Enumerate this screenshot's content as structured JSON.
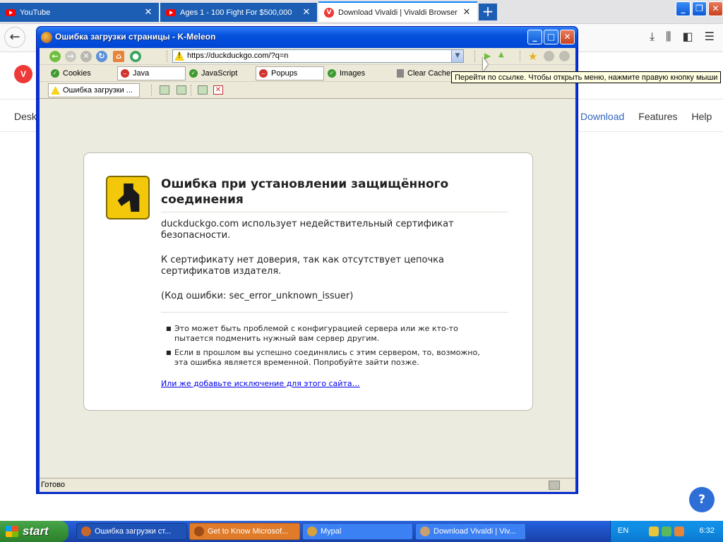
{
  "firefox": {
    "tabs": [
      {
        "label": "YouTube",
        "icon": "youtube-icon"
      },
      {
        "label": "Ages 1 - 100 Fight For $500,000",
        "icon": "youtube-icon"
      },
      {
        "label": "Download Vivaldi | Vivaldi Browser",
        "icon": "vivaldi-icon"
      }
    ],
    "new_tab": "+",
    "vivaldi_logo": "V",
    "vivaldi_nav_left": "Desk",
    "vivaldi_nav_right": [
      "Download",
      "Features",
      "Help"
    ],
    "help_button": "?"
  },
  "kmeleon": {
    "title": "Ошибка загрузки страницы - K-Meleon",
    "url": "https://duckduckgo.com/?q=n",
    "toggles": [
      {
        "label": "Cookies",
        "state": "on"
      },
      {
        "label": "Java",
        "state": "off"
      },
      {
        "label": "JavaScript",
        "state": "on"
      },
      {
        "label": "Popups",
        "state": "off"
      },
      {
        "label": "Images",
        "state": "on"
      },
      {
        "label": "Clear Cache",
        "state": "action"
      }
    ],
    "tab_label": "Ошибка загрузки ...",
    "tooltip": "Перейти по ссылке. Чтобы открыть меню, нажмите правую кнопку мыши",
    "status": "Готово",
    "error": {
      "title": "Ошибка при установлении защищённого соединения",
      "p1": "duckduckgo.com использует недействительный сертификат безопасности.",
      "p2": "К сертификату нет доверия, так как отсутствует цепочка сертификатов издателя.",
      "p3": "(Код ошибки: sec_error_unknown_issuer)",
      "bullets": [
        "Это может быть проблемой с конфигурацией сервера или же кто-то пытается подменить нужный вам сервер другим.",
        "Если в прошлом вы успешно соединялись с этим сервером, то, возможно, эта ошибка является временной. Попробуйте зайти позже."
      ],
      "link": "Или же добавьте исключение для этого сайта…"
    }
  },
  "taskbar": {
    "start": "start",
    "tasks": [
      {
        "label": "Ошибка загрузки ст...",
        "state": "active"
      },
      {
        "label": "Get to Know Microsof...",
        "state": "flash"
      },
      {
        "label": "Mypal",
        "state": "normal"
      },
      {
        "label": "Download Vivaldi | Viv...",
        "state": "normal"
      }
    ],
    "lang": "EN",
    "clock": "6:32"
  },
  "colors": {
    "xp_blue": "#0831d9",
    "warning_yellow": "#f3c70a",
    "link_blue": "#0000ee",
    "vivaldi_red": "#ef3939"
  }
}
